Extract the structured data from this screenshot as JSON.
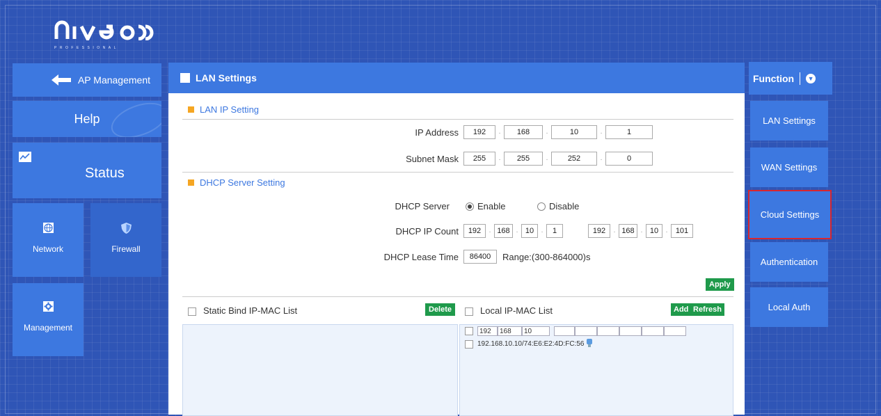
{
  "brand": {
    "logo_text": "NIVEON",
    "logo_sub": "PROFESSIONAL"
  },
  "sidebar": {
    "ap_label": "AP Management",
    "help_label": "Help",
    "status_label": "Status",
    "network_label": "Network",
    "firewall_label": "Firewall",
    "management_label": "Management"
  },
  "panel": {
    "title": "LAN Settings",
    "lan_section": "LAN IP Setting",
    "ip_label": "IP Address",
    "ip": [
      "192",
      "168",
      "10",
      "1"
    ],
    "mask_label": "Subnet Mask",
    "mask": [
      "255",
      "255",
      "252",
      "0"
    ],
    "dhcp_section": "DHCP Server Setting",
    "dhcp_server_label": "DHCP Server",
    "enable_label": "Enable",
    "disable_label": "Disable",
    "dhcp_enabled": true,
    "dhcp_count_label": "DHCP IP Count",
    "dhcp_start": [
      "192",
      "168",
      "10",
      "1"
    ],
    "dhcp_end": [
      "192",
      "168",
      "10",
      "101"
    ],
    "lease_label": "DHCP Lease Time",
    "lease_value": "86400",
    "lease_range": "Range:(300-864000)s",
    "apply_label": "Apply",
    "static_list_label": "Static Bind IP-MAC List",
    "delete_label": "Delete",
    "local_list_label": "Local IP-MAC List",
    "add_label": "Add",
    "refresh_label": "Refresh",
    "filter_ip": [
      "192",
      "168",
      "10"
    ],
    "local_entry": "192.168.10.10/74:E6:E2:4D:FC:56"
  },
  "function_menu": {
    "title": "Function",
    "items": [
      "LAN Settings",
      "WAN Settings",
      "Cloud Settings",
      "Authentication",
      "Local Auth"
    ],
    "highlighted": "Cloud Settings"
  },
  "colors": {
    "accent": "#3d78e0",
    "background": "#2f55b6",
    "green_button": "#1f9a4b",
    "highlight": "#d9262e",
    "section_bullet": "#f5a623"
  }
}
